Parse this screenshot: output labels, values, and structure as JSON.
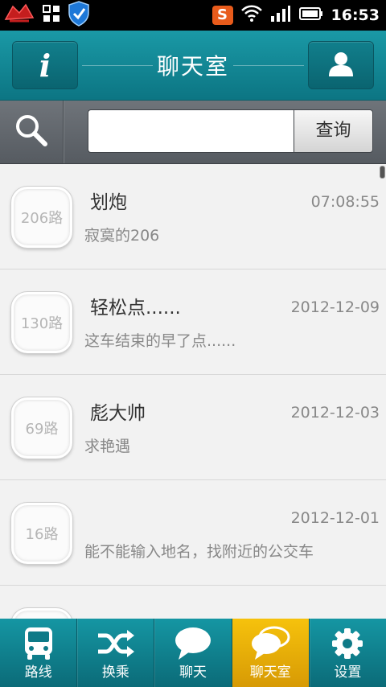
{
  "status_bar": {
    "time": "16:53",
    "left_icons": [
      "app-icon",
      "grid-icon",
      "shield-icon"
    ],
    "right_icons": [
      "sogou-input-icon",
      "wifi-icon",
      "signal-icon",
      "battery-icon"
    ],
    "sogou_label": "S"
  },
  "header": {
    "title": "聊天室",
    "info_label": "i"
  },
  "search": {
    "value": "",
    "button_label": "查询"
  },
  "chat_list": [
    {
      "route": "206路",
      "name": "划炮",
      "time": "07:08:55",
      "message": "寂寞的206"
    },
    {
      "route": "130路",
      "name": "轻松点......",
      "time": "2012-12-09",
      "message": "这车结束的早了点......"
    },
    {
      "route": "69路",
      "name": "彪大帅",
      "time": "2012-12-03",
      "message": "求艳遇"
    },
    {
      "route": "16路",
      "name": "",
      "time": "2012-12-01",
      "message": "能不能输入地名，找附近的公交车"
    },
    {
      "route": "",
      "name": "",
      "time": "",
      "message": ""
    }
  ],
  "tabs": [
    {
      "label": "路线",
      "icon": "bus-icon"
    },
    {
      "label": "换乘",
      "icon": "shuffle-icon"
    },
    {
      "label": "聊天",
      "icon": "chat-bubble-icon"
    },
    {
      "label": "聊天室",
      "icon": "chat-room-icon",
      "active": true
    },
    {
      "label": "设置",
      "icon": "gear-icon"
    }
  ],
  "colors": {
    "header": "#0f8593",
    "active_tab": "#e9ae07",
    "list_bg": "#f2f2f2"
  }
}
